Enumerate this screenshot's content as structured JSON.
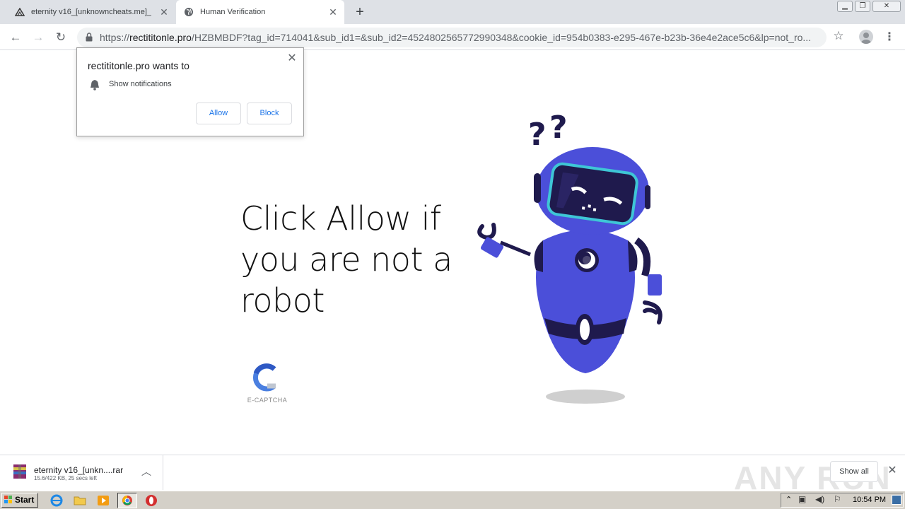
{
  "browser": {
    "tabs": [
      {
        "title": "eternity v16_[unknowncheats.me]_",
        "icon": "uc-icon"
      },
      {
        "title": "Human Verification",
        "icon": "globe-icon"
      }
    ],
    "url_host": "rectititonle.pro",
    "url_rest": "/HZBMBDF?tag_id=714041&sub_id1=&sub_id2=4524802565772990348&cookie_id=954b0383-e295-467e-b23b-36e4e2ace5c6&lp=not_ro...",
    "url_scheme": "https://"
  },
  "notification": {
    "title": "rectititonle.pro wants to",
    "permission": "Show notifications",
    "allow": "Allow",
    "block": "Block"
  },
  "page": {
    "headline": "Click Allow if you are not a robot",
    "captcha_label": "E-CAPTCHA"
  },
  "downloads": {
    "file_name": "eternity v16_[unkn....rar",
    "status": "15.6/422 KB, 25 secs left",
    "show_all": "Show all",
    "watermark": "ANY RUN"
  },
  "taskbar": {
    "start": "Start",
    "clock": "10:54 PM"
  },
  "colors": {
    "robot_body": "#4b4fd9",
    "robot_dark": "#1f1a4d",
    "visor": "#3ec6d6",
    "link_blue": "#1a73e8"
  }
}
